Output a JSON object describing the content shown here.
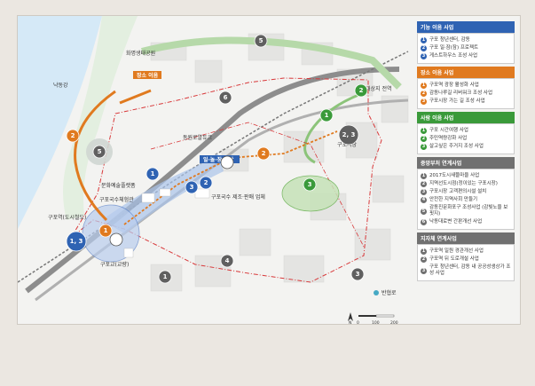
{
  "map_labels": {
    "han_river": "낙동강",
    "eco_park": "화명생태공원",
    "space_use": "장소 이음",
    "diagonal": "대상지 전역",
    "dongwon": "동원로얄듀크",
    "gupo_market": "구포시장",
    "ilnu_spread": "일·놀·잠 확산",
    "culture_center": "문화예술플랫폼",
    "noodle_exp": "구포국수체험관",
    "noodle_sales": "구포국수\n제조·판매 업체",
    "gupo_station": "구포역(도시철도)",
    "gupo_bridge": "구포교(교량)",
    "branch_road": "반협로"
  },
  "markers": [
    {
      "id": "m5a",
      "label": "5",
      "color": "#606060"
    },
    {
      "id": "m2a",
      "label": "2",
      "color": "#e07a1f"
    },
    {
      "id": "m5b",
      "label": "5",
      "color": "#606060"
    },
    {
      "id": "m6",
      "label": "6",
      "color": "#606060"
    },
    {
      "id": "m2b",
      "label": "2",
      "color": "#3a9a3a"
    },
    {
      "id": "m1g",
      "label": "1",
      "color": "#3a9a3a"
    },
    {
      "id": "m23",
      "label": "2, 3",
      "color": "#606060"
    },
    {
      "id": "m2o",
      "label": "2",
      "color": "#e07a1f"
    },
    {
      "id": "m2w",
      "label": "2",
      "color": "#ffffff"
    },
    {
      "id": "m1b",
      "label": "1",
      "color": "#2f63b3"
    },
    {
      "id": "m3b",
      "label": "3",
      "color": "#2f63b3"
    },
    {
      "id": "m2bb",
      "label": "2",
      "color": "#2f63b3"
    },
    {
      "id": "m3g",
      "label": "3",
      "color": "#3a9a3a"
    },
    {
      "id": "m4",
      "label": "4",
      "color": "#606060"
    },
    {
      "id": "m1d",
      "label": "1",
      "color": "#606060"
    },
    {
      "id": "m13",
      "label": "1, 3",
      "color": "#2f63b3"
    },
    {
      "id": "m1o",
      "label": "1",
      "color": "#e07a1f"
    },
    {
      "id": "m1w",
      "label": "1",
      "color": "#ffffff"
    },
    {
      "id": "m3d",
      "label": "3",
      "color": "#606060"
    }
  ],
  "legend": {
    "groups": [
      {
        "title": "기능 이음 사업",
        "color": "#2f63b3",
        "items": [
          "구포 청년센터, 감동",
          "구포 일·잠(잠) 프로젝트",
          "게스트하우스 조성 사업"
        ]
      },
      {
        "title": "장소 이음 사업",
        "color": "#e07a1f",
        "items": [
          "구포역 광장 활성화 사업",
          "감동나루길 리버워크 조성 사업",
          "구포시장 가는 길 조성 사업"
        ]
      },
      {
        "title": "사람 이음 사업",
        "color": "#3a9a3a",
        "items": [
          "구포 시간여행 사업",
          "주민역량강화 사업",
          "살고싶은 주거지 조성 사업"
        ]
      },
      {
        "title": "중앙부처 연계사업",
        "color": "#707070",
        "items": [
          "2017도시새뜰마을 사업",
          "지역선도시점(정이있는 구포시장)",
          "구포시장 고객편의시설 설치",
          "안전한 지역사회 만들기",
          "감동진문화포구 조성사업 (감빛노을 보핏지)",
          "낙동대로변 간판개선 사업"
        ]
      },
      {
        "title": "지자체 연계사업",
        "color": "#707070",
        "items": [
          "구포역 일원 경관개선 사업",
          "구포역 뒤 도로개설 사업",
          "구포 청년센터, 감동 내 공공성생상가 조성 사업"
        ]
      }
    ]
  },
  "scale": {
    "n": "N",
    "zero": "0",
    "hundred": "100",
    "two_hundred": "200"
  }
}
